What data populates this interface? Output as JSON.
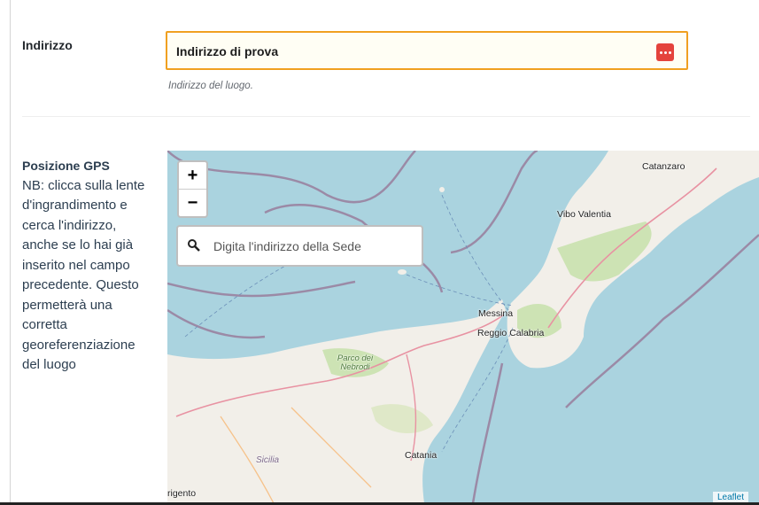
{
  "address": {
    "label": "Indirizzo",
    "value": "Indirizzo di prova",
    "description": "Indirizzo del luogo."
  },
  "gps": {
    "title": "Posizione GPS",
    "note": "NB: clicca sulla lente d'ingrandimento e cerca l'indirizzo, anche se lo hai già inserito nel campo precedente. Questo permetterà una corretta georeferenziazione del luogo"
  },
  "map": {
    "zoom_in": "+",
    "zoom_out": "−",
    "search_placeholder": "Digita l'indirizzo della Sede",
    "attribution": "Leaflet",
    "labels": {
      "catanzaro": "Catanzaro",
      "vibo": "Vibo Valentia",
      "messina": "Messina",
      "reggio": "Reggio Calabria",
      "parco": "Parco dei Nebrodi",
      "catania": "Catania",
      "sicilia": "Sicilia",
      "agrigento": "rigento"
    }
  },
  "colors": {
    "sea": "#aad3df",
    "land": "#f2efe9",
    "forest": "#cde3b4",
    "focus_border": "#f0a020",
    "dots_button": "#e4433c"
  },
  "icons": [
    "more-dots-icon",
    "search-icon",
    "zoom-in-icon",
    "zoom-out-icon"
  ]
}
